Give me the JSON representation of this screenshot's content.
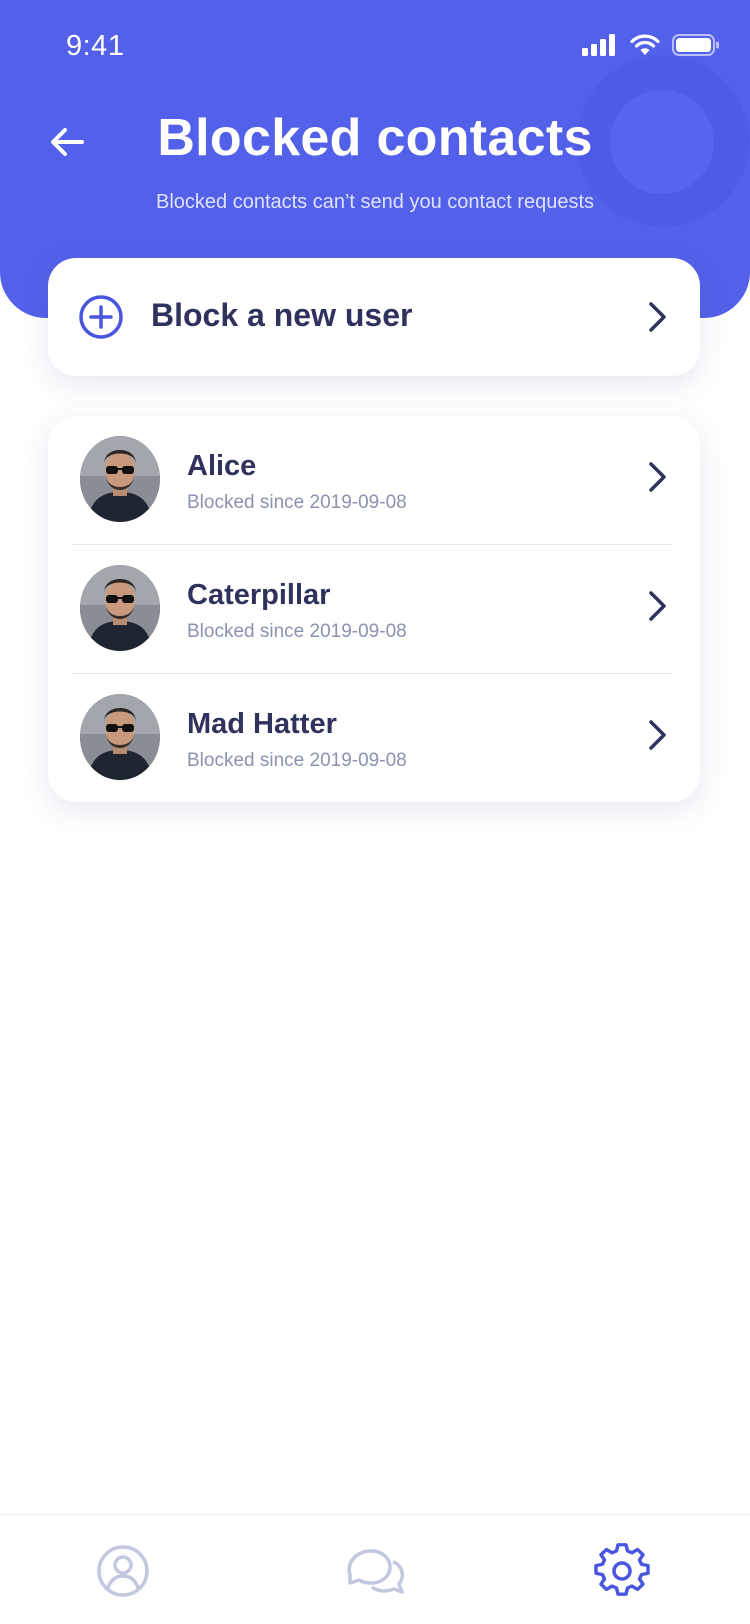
{
  "status_bar": {
    "time": "9:41"
  },
  "header": {
    "title": "Blocked contacts",
    "subtitle": "Blocked contacts can’t send you contact requests"
  },
  "block_new": {
    "label": "Block a new user"
  },
  "blocked_list": [
    {
      "name": "Alice",
      "since": "Blocked since 2019-09-08"
    },
    {
      "name": "Caterpillar",
      "since": "Blocked since 2019-09-08"
    },
    {
      "name": "Mad Hatter",
      "since": "Blocked since 2019-09-08"
    }
  ],
  "tab_bar": {
    "tabs": [
      {
        "icon": "profile-icon",
        "active": false
      },
      {
        "icon": "chat-icon",
        "active": false
      },
      {
        "icon": "gear-icon",
        "active": true
      }
    ]
  },
  "colors": {
    "accent": "#5360ea",
    "title_text": "#30325e",
    "secondary_text": "#8c91b0",
    "inactive_tab": "#c3c7df"
  }
}
